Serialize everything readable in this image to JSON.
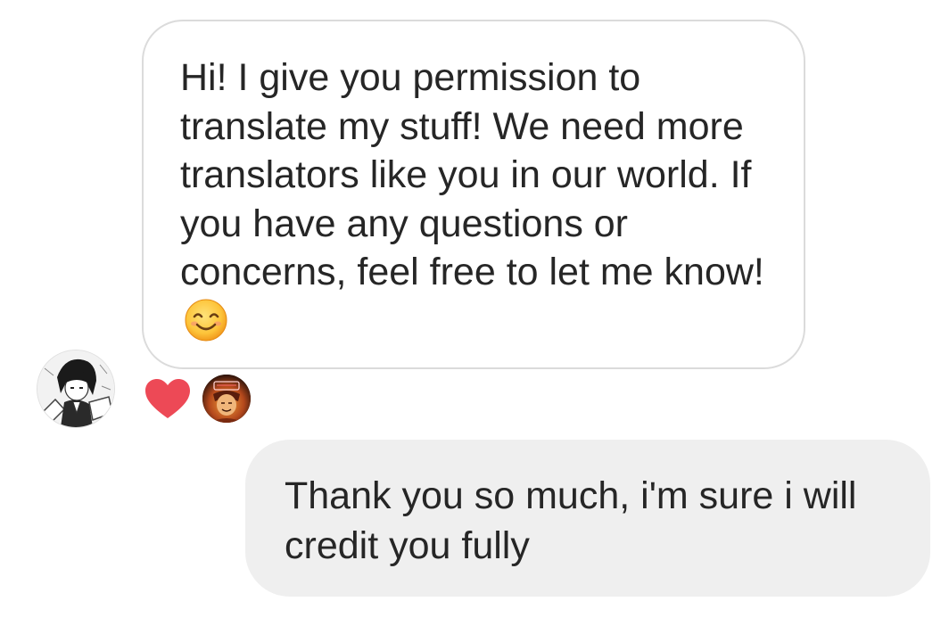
{
  "conversation": {
    "incoming": {
      "text": "Hi! I give you permission to translate my stuff! We need more translators like you in our world. If you have any questions or concerns, feel free to let me know!",
      "emoji": "smiling-face-icon"
    },
    "reaction": {
      "icon": "heart-icon",
      "color": "#ed4956"
    },
    "outgoing": {
      "text": "Thank you so much, i'm sure i will credit you fully",
      "background": "#efefef"
    }
  }
}
